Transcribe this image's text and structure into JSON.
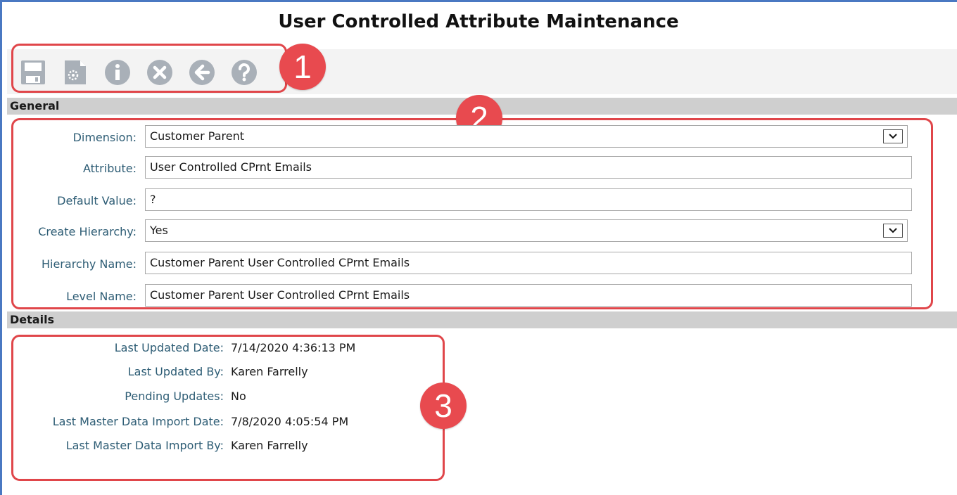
{
  "page": {
    "title": "User Controlled Attribute Maintenance"
  },
  "toolbar": {
    "buttons": [
      {
        "icon": "save-icon"
      },
      {
        "icon": "document-settings-icon"
      },
      {
        "icon": "info-icon"
      },
      {
        "icon": "cancel-icon"
      },
      {
        "icon": "back-arrow-icon"
      },
      {
        "icon": "help-icon"
      }
    ],
    "icon_color": "#a9b0b8"
  },
  "callouts": {
    "one": "1",
    "two": "2",
    "three": "3",
    "color": "#e84a4f"
  },
  "general": {
    "header": "General",
    "dimension": {
      "label": "Dimension:",
      "value": "Customer Parent"
    },
    "attribute": {
      "label": "Attribute:",
      "value": "User Controlled CPrnt Emails"
    },
    "default_value": {
      "label": "Default Value:",
      "value": "?"
    },
    "create_hierarchy": {
      "label": "Create Hierarchy:",
      "value": "Yes"
    },
    "hierarchy_name": {
      "label": "Hierarchy Name:",
      "value": "Customer Parent User Controlled CPrnt Emails"
    },
    "level_name": {
      "label": "Level Name:",
      "value": "Customer Parent User Controlled CPrnt Emails"
    }
  },
  "details": {
    "header": "Details",
    "last_updated_date": {
      "label": "Last Updated Date:",
      "value": "7/14/2020 4:36:13 PM"
    },
    "last_updated_by": {
      "label": "Last Updated By:",
      "value": "Karen Farrelly"
    },
    "pending_updates": {
      "label": "Pending Updates:",
      "value": "No"
    },
    "last_import_date": {
      "label": "Last Master Data Import Date:",
      "value": "7/8/2020 4:05:54 PM"
    },
    "last_import_by": {
      "label": "Last Master Data Import By:",
      "value": "Karen Farrelly"
    }
  }
}
